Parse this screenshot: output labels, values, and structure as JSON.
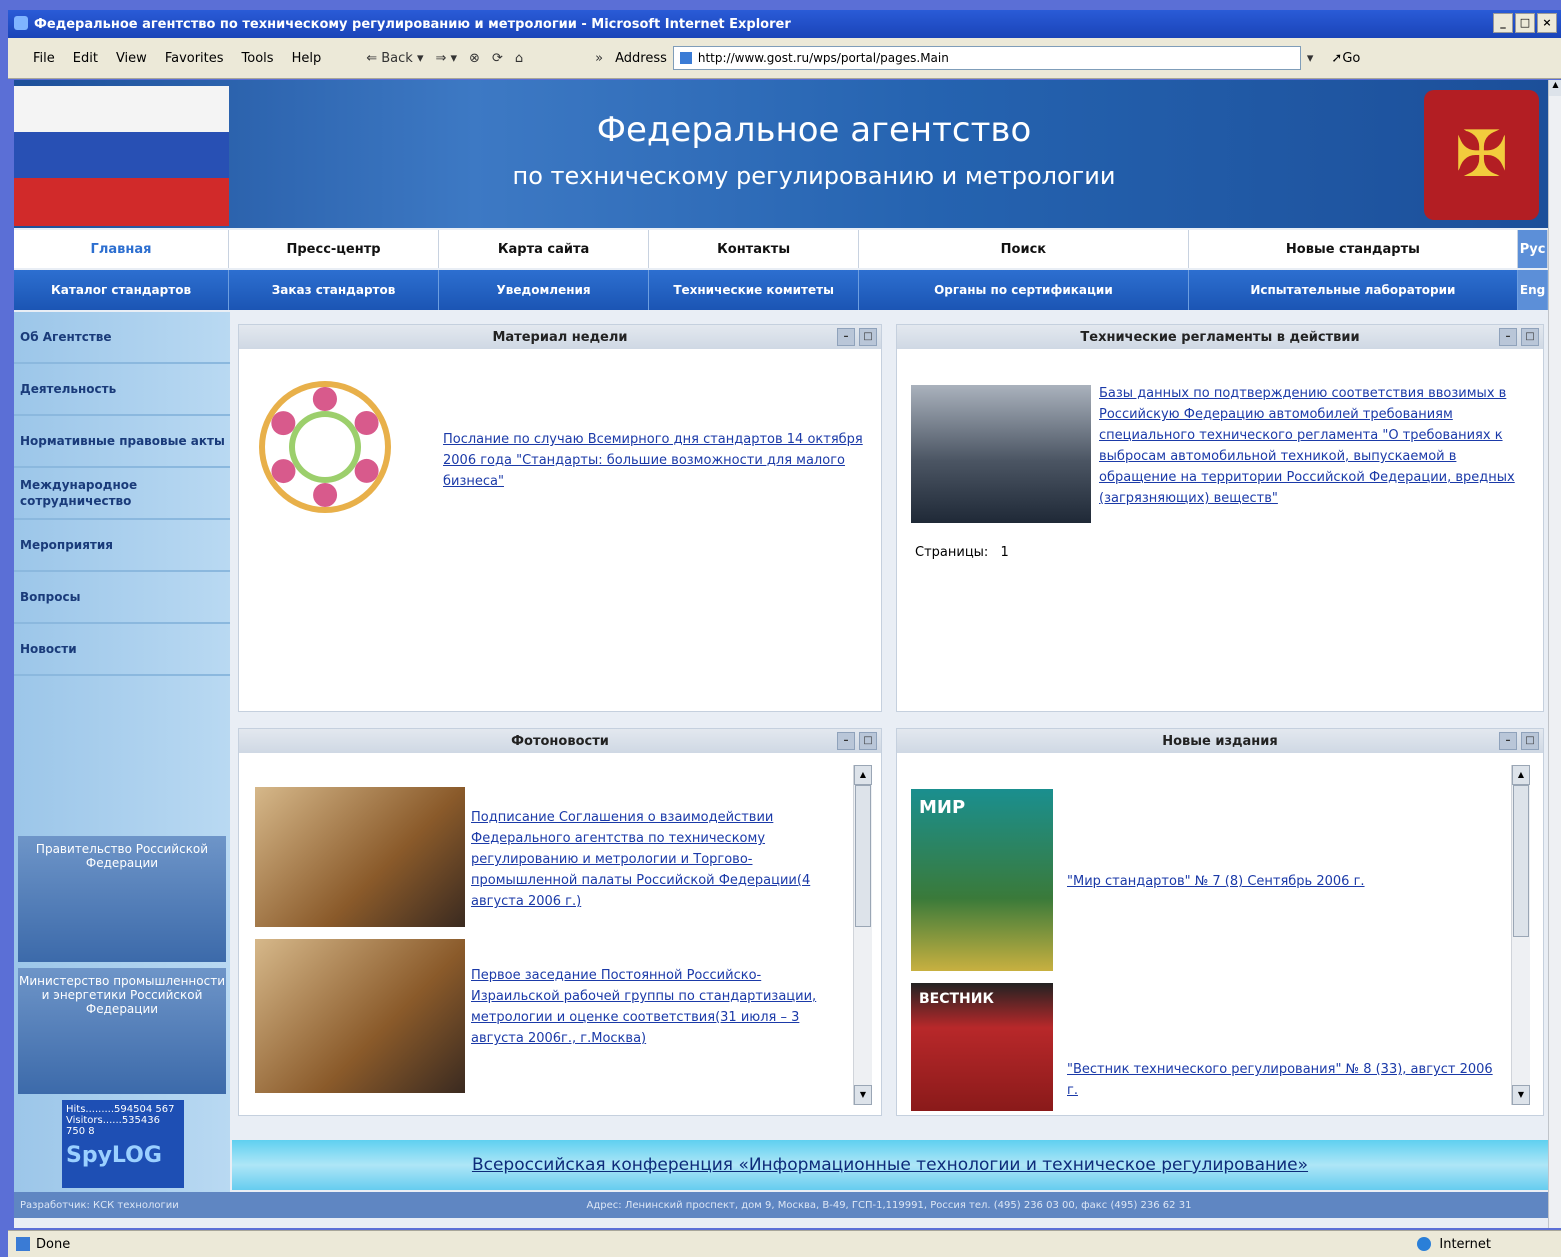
{
  "window": {
    "title": "Федеральное агентство по техническому регулированию и метрологии - Microsoft Internet Explorer",
    "menu": [
      "File",
      "Edit",
      "View",
      "Favorites",
      "Tools",
      "Help"
    ],
    "back_label": "Back",
    "address_label": "Address",
    "address_url": "http://www.gost.ru/wps/portal/pages.Main",
    "go_label": "Go",
    "status_text": "Done",
    "zone_text": "Internet"
  },
  "banner": {
    "title": "Федеральное агентство",
    "subtitle": "по техническому регулированию и метрологии"
  },
  "nav_top": [
    "Главная",
    "Пресс-центр",
    "Карта сайта",
    "Контакты",
    "Поиск",
    "Новые стандарты",
    "Рус"
  ],
  "nav_bottom": [
    "Каталог стандартов",
    "Заказ стандартов",
    "Уведомления",
    "Технические комитеты",
    "Органы по сертификации",
    "Испытательные лаборатории",
    "Eng"
  ],
  "sidebar": {
    "items": [
      "Об Агентстве",
      "Деятельность",
      "Нормативные правовые акты",
      "Международное сотрудничество",
      "Мероприятия",
      "Вопросы",
      "Новости"
    ],
    "banner_gov": "Правительство Российской Федерации",
    "banner_min": "Министерство промышленности и энергетики Российской Федерации",
    "counter_hits": "Hits.........594504 567",
    "counter_visitors": "Visitors......535436 750 8",
    "counter_logo": "SpyLOG"
  },
  "portlets": {
    "material": {
      "title": "Материал недели",
      "link": "Послание по случаю Всемирного дня стандартов 14 октября 2006 года \"Стандарты: большие возможности для малого бизнеса\""
    },
    "regulations": {
      "title": "Технические регламенты в действии",
      "link": "Базы данных по подтверждению соответствия ввозимых в Российскую Федерацию автомобилей требованиям специального технического регламента \"О требованиях к выбросам автомобильной техникой, выпускаемой в обращение на территории Российской Федерации, вредных (загрязняющих) веществ\"",
      "pages_label": "Страницы:",
      "pages_value": "1"
    },
    "photonews": {
      "title": "Фотоновости",
      "item1": "Подписание Соглашения о взаимодействии Федерального агентства по техническому регулированию и метрологии и Торгово-промышленной палаты Российской Федерации(4 августа 2006 г.)",
      "item2": "Первое заседание Постоянной Российско-Израильской рабочей группы по стандартизации, метрологии и оценке соответствия(31 июля – 3 августа 2006г., г.Москва)"
    },
    "editions": {
      "title": "Новые издания",
      "item1": "\"Мир стандартов\" № 7 (8) Сентябрь 2006 г.",
      "item2": "\"Вестник технического регулирования\" № 8 (33), август 2006 г.",
      "mag1_label": "МИР",
      "mag2_label": "ВЕСТНИК"
    }
  },
  "conference": "Всероссийская конференция «Информационные технологии и техническое регулирование»",
  "footer": {
    "left": "Разработчик: КСК технологии",
    "address": "Адрес: Ленинский проспект, дом 9, Москва, В-49, ГСП-1,119991, Россия тел. (495) 236 03 00, факс (495) 236 62 31"
  },
  "colors": {
    "accent": "#1b55b4",
    "link": "#1b3aa8",
    "banner": "#2563b0"
  }
}
